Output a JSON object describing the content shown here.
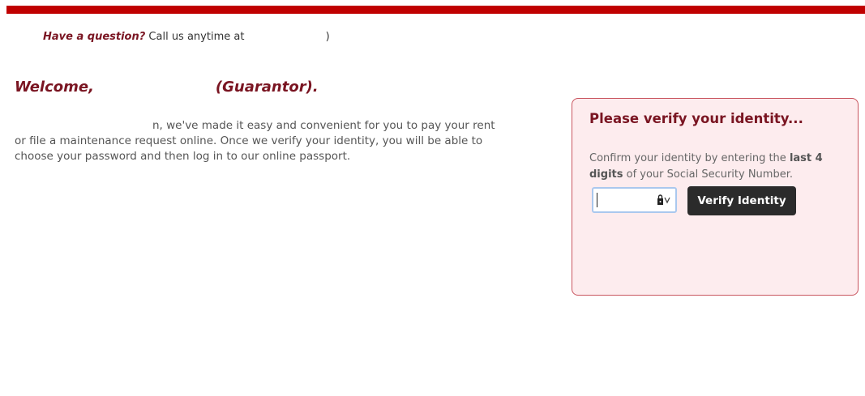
{
  "header": {
    "question_strong": "Have a question?",
    "question_text": " Call us anytime at ",
    "question_tail": ")"
  },
  "welcome": {
    "prefix": "Welcome,",
    "suffix": "(Guarantor)."
  },
  "intro": {
    "line1": "n, we've made it easy and convenient for you to pay your rent",
    "line2": "or file a maintenance request online. Once we verify your identity, you will be able to",
    "line3": "choose your password and then log in to our online passport."
  },
  "verify": {
    "title": "Please verify your identity...",
    "text_before": "Confirm your identity by entering the ",
    "text_bold": "last 4 digits",
    "text_after": " of your Social Security Number.",
    "input_value": "",
    "input_placeholder": "",
    "button_label": "Verify Identity"
  },
  "colors": {
    "top_bar": "#c00000",
    "brand_dark_red": "#7a1522",
    "panel_bg": "#fdecee",
    "panel_border": "#c9555f",
    "button_bg": "#2b2b2b"
  },
  "icons": {
    "input_icon": "key-lock-icon"
  }
}
